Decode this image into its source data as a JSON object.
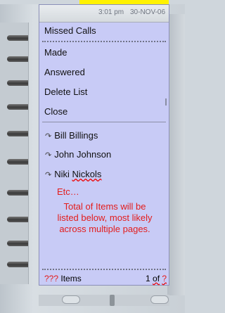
{
  "status": {
    "time": "3:01 pm",
    "date": "30-NOV-06"
  },
  "menu": {
    "title": "Missed Calls",
    "items": [
      "Made",
      "Answered",
      "Delete List",
      "Close"
    ]
  },
  "contacts": [
    {
      "name": "Bill Billings"
    },
    {
      "name": "John Johnson"
    },
    {
      "first": "Niki",
      "last": "Nickols"
    }
  ],
  "notes": {
    "etc": "Etc…",
    "total_items_line1": "Total of Items will be",
    "total_items_line2": "listed below, most likely",
    "total_items_line3": "across multiple pages."
  },
  "footer": {
    "items_prefix": "???",
    "items_label": " Items",
    "page_prefix": "1 ",
    "page_of": "of",
    "page_total": "?"
  },
  "icons": {
    "contact": "reply-arrow-icon"
  },
  "colors": {
    "screen_bg": "#c8cbf6",
    "highlight_red": "#e31c1c",
    "top_yellow": "#fff200"
  }
}
